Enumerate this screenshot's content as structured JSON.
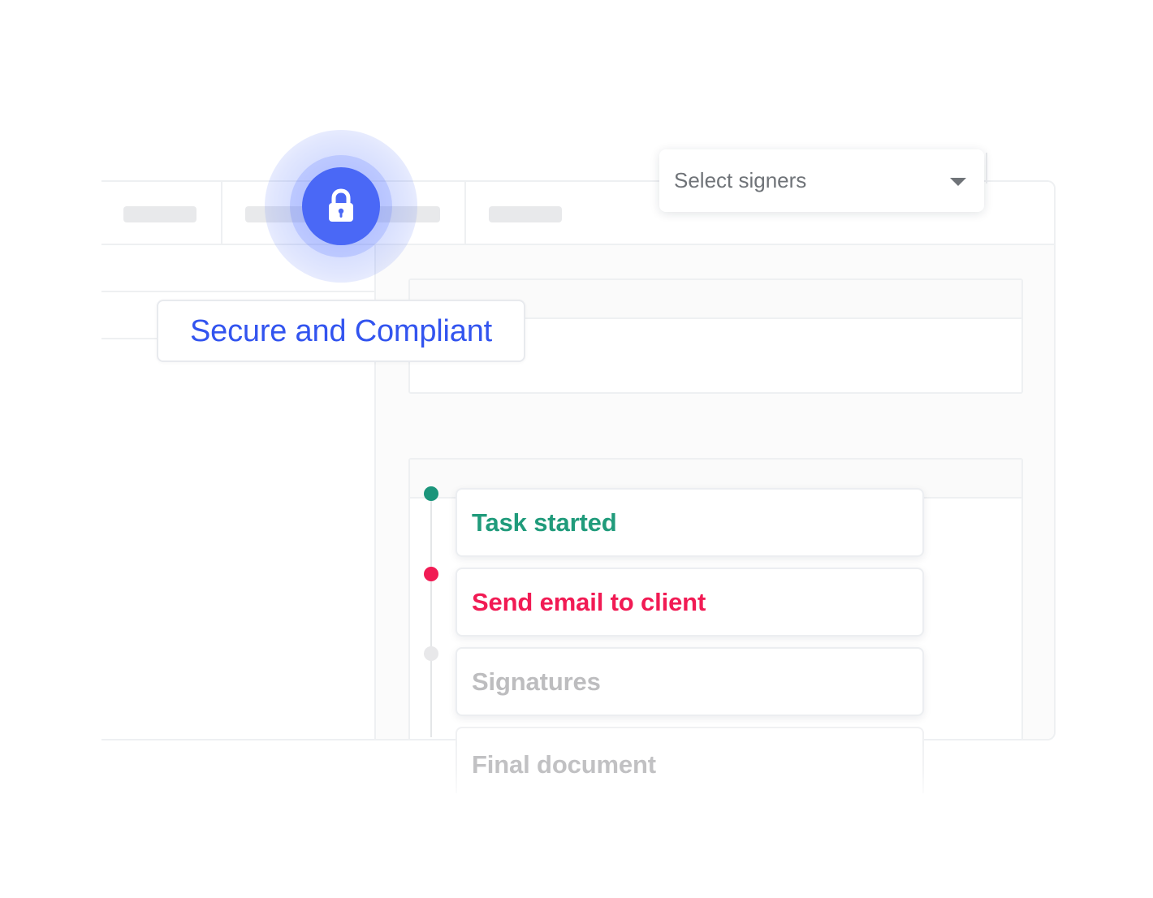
{
  "app": {
    "title": ""
  },
  "signers": {
    "placeholder": "Select signers"
  },
  "security_badge": {
    "label": "Secure and Compliant",
    "icon": "lock-icon"
  },
  "timeline": {
    "items": [
      {
        "label": "Task started",
        "color": "#209b7b",
        "dot_color": "#1b957b",
        "state": "completed"
      },
      {
        "label": "Send email to client",
        "color": "#f11b54",
        "dot_color": "#f11b54",
        "state": "active"
      },
      {
        "label": "Signatures",
        "color": "#bdbdbf",
        "dot_color": "#e8e8ea",
        "state": "pending"
      },
      {
        "label": "Final document",
        "color": "#c1c1c3",
        "dot_color": "#e8e8ea",
        "state": "pending"
      }
    ]
  },
  "colors": {
    "accent_blue": "#4a68f6",
    "compliance_text": "#3254ef",
    "border": "#eef0f2",
    "placeholder_gray": "#e8e9eb"
  },
  "icons": {
    "dropdown": "chevron-down-icon",
    "security": "lock-icon"
  }
}
